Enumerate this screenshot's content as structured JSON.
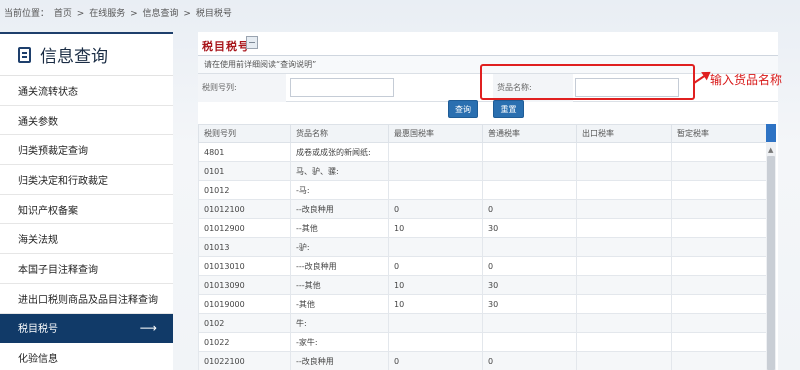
{
  "breadcrumb": {
    "prefix": "当前位置：",
    "items": [
      "首页",
      "在线服务",
      "信息查询",
      "税目税号"
    ],
    "separator": ">"
  },
  "sidebar": {
    "title": "信息查询",
    "items": [
      {
        "label": "通关流转状态"
      },
      {
        "label": "通关参数"
      },
      {
        "label": "归类预裁定查询"
      },
      {
        "label": "归类决定和行政裁定"
      },
      {
        "label": "知识产权备案"
      },
      {
        "label": "海关法规"
      },
      {
        "label": "本国子目注释查询"
      },
      {
        "label": "进出口税则商品及品目注释查询"
      },
      {
        "label": "税目税号",
        "active": true,
        "arrow": "⟶"
      },
      {
        "label": "化验信息"
      }
    ]
  },
  "panel": {
    "title": "税目税号",
    "notice": "请在使用前详细阅读“查询说明”",
    "form": {
      "tariff_label": "税则号列:",
      "tariff_value": "",
      "goods_label": "货品名称:",
      "goods_value": ""
    },
    "query_button": "查询",
    "reset_button": "重置"
  },
  "annotation": {
    "text": "输入货品名称",
    "color": "#e02020"
  },
  "table": {
    "headers": [
      "税则号列",
      "货品名称",
      "最惠国税率",
      "普通税率",
      "出口税率",
      "暂定税率"
    ],
    "rows": [
      [
        "4801",
        "成卷或成张的新闻纸:",
        "",
        "",
        "",
        ""
      ],
      [
        "0101",
        "马、驴、骡:",
        "",
        "",
        "",
        ""
      ],
      [
        "01012",
        "-马:",
        "",
        "",
        "",
        ""
      ],
      [
        "01012100",
        "--改良种用",
        "0",
        "0",
        "",
        ""
      ],
      [
        "01012900",
        "--其他",
        "10",
        "30",
        "",
        ""
      ],
      [
        "01013",
        "-驴:",
        "",
        "",
        "",
        ""
      ],
      [
        "01013010",
        "---改良种用",
        "0",
        "0",
        "",
        ""
      ],
      [
        "01013090",
        "---其他",
        "10",
        "30",
        "",
        ""
      ],
      [
        "01019000",
        "-其他",
        "10",
        "30",
        "",
        ""
      ],
      [
        "0102",
        "牛:",
        "",
        "",
        "",
        ""
      ],
      [
        "01022",
        "-家牛:",
        "",
        "",
        "",
        ""
      ],
      [
        "01022100",
        "--改良种用",
        "0",
        "0",
        "",
        ""
      ]
    ]
  },
  "colors": {
    "sidebar_active": "#113a68",
    "title_red": "#a8151b",
    "button_blue": "#2a6fb0",
    "scroll_accent": "#2e73c4"
  }
}
